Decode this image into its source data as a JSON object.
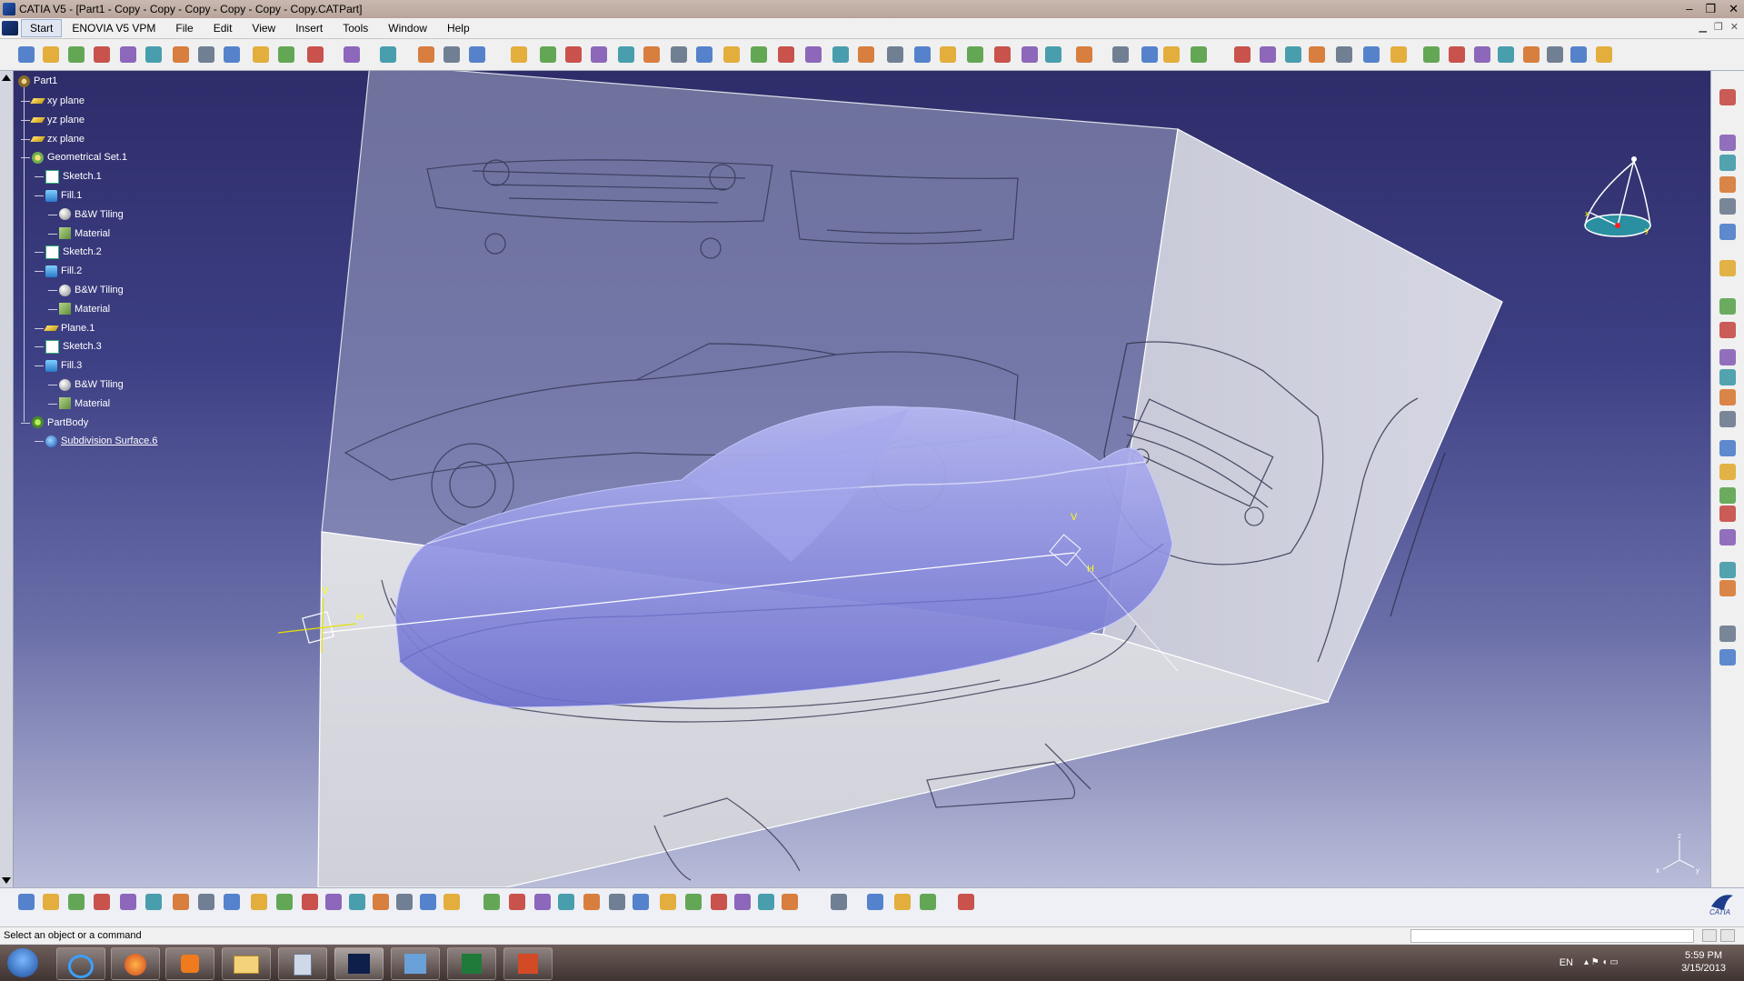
{
  "window": {
    "title": "CATIA V5 - [Part1 - Copy - Copy - Copy - Copy - Copy - Copy.CATPart]",
    "minimize": "–",
    "restore": "❐",
    "close": "✕"
  },
  "menu": {
    "items": [
      "Start",
      "ENOVIA V5 VPM",
      "File",
      "Edit",
      "View",
      "Insert",
      "Tools",
      "Window",
      "Help"
    ]
  },
  "tree": {
    "root": "Part1",
    "nodes": [
      {
        "label": "xy plane",
        "icon": "plane-icon"
      },
      {
        "label": "yz plane",
        "icon": "plane-icon"
      },
      {
        "label": "zx plane",
        "icon": "plane-icon"
      },
      {
        "label": "Geometrical Set.1",
        "icon": "geometrical-set-icon"
      },
      {
        "label": "Sketch.1",
        "icon": "sketch-icon"
      },
      {
        "label": "Fill.1",
        "icon": "fill-icon"
      },
      {
        "label": "B&W Tiling",
        "icon": "texture-icon"
      },
      {
        "label": "Material",
        "icon": "material-icon"
      },
      {
        "label": "Sketch.2",
        "icon": "sketch-icon"
      },
      {
        "label": "Fill.2",
        "icon": "fill-icon"
      },
      {
        "label": "B&W Tiling",
        "icon": "texture-icon"
      },
      {
        "label": "Material",
        "icon": "material-icon"
      },
      {
        "label": "Plane.1",
        "icon": "plane-icon"
      },
      {
        "label": "Sketch.3",
        "icon": "sketch-icon"
      },
      {
        "label": "Fill.3",
        "icon": "fill-icon"
      },
      {
        "label": "B&W Tiling",
        "icon": "texture-icon"
      },
      {
        "label": "Material",
        "icon": "material-icon"
      },
      {
        "label": "PartBody",
        "icon": "partbody-icon"
      },
      {
        "label": "Subdivision Surface.6",
        "icon": "subdivision-surface-icon"
      }
    ]
  },
  "viewport": {
    "compass_labels": {
      "x": "x",
      "y": "y",
      "z": "z"
    },
    "axis_labels": {
      "v": "V",
      "h": "H"
    },
    "triad_labels": {
      "z": "z",
      "x": "x",
      "y": "y"
    }
  },
  "status": {
    "message": "Select an object or a command"
  },
  "taskbar": {
    "language": "EN",
    "time": "5:59 PM",
    "date": "3/15/2013"
  },
  "brand": {
    "logo_text": "CATIA"
  },
  "colors": {
    "accent": "#3d3f84",
    "surface": "#8c8fe0"
  }
}
